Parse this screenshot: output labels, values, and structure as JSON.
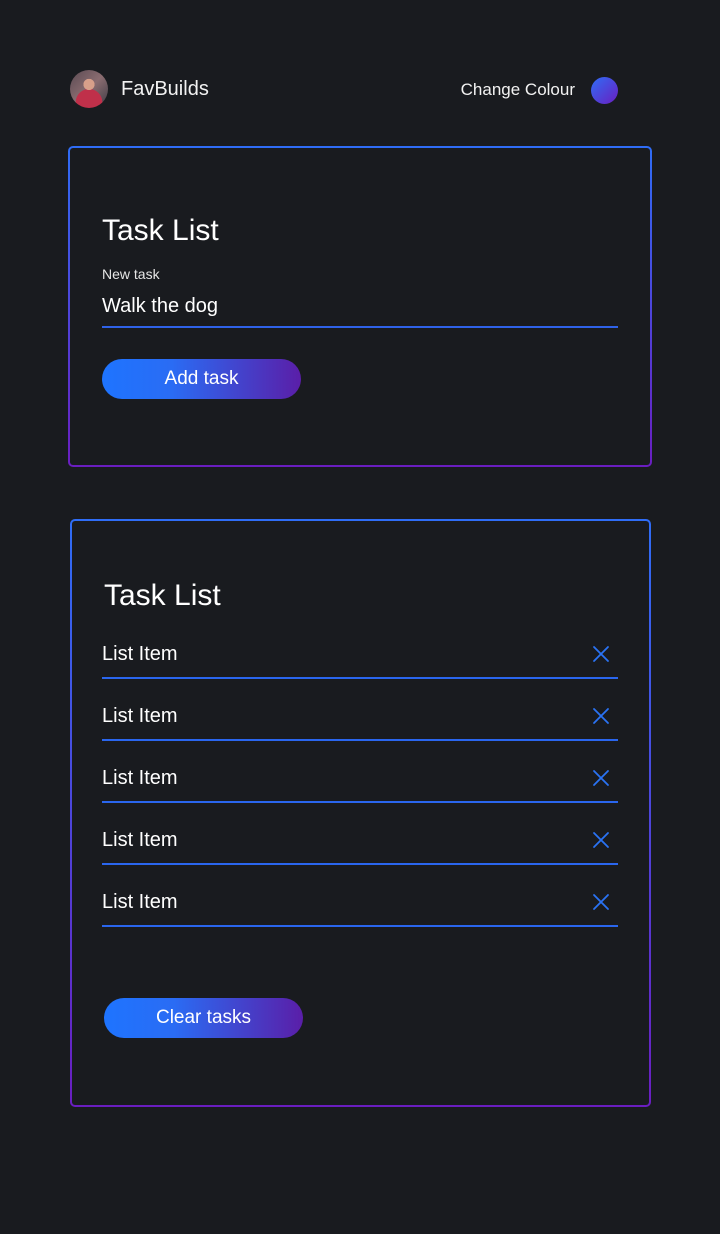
{
  "header": {
    "brand": "FavBuilds",
    "change_colour_label": "Change Colour"
  },
  "colors": {
    "background": "#191b1f",
    "accent_start": "#1e74ff",
    "accent_end": "#5a1ea8",
    "underline": "#2a66ee"
  },
  "new_task_card": {
    "title": "Task List",
    "field_label": "New task",
    "input_value": "Walk the dog",
    "add_button_label": "Add task"
  },
  "task_list_card": {
    "title": "Task List",
    "items": [
      {
        "label": "List Item",
        "icon": "close-icon"
      },
      {
        "label": "List Item",
        "icon": "close-icon"
      },
      {
        "label": "List Item",
        "icon": "close-icon"
      },
      {
        "label": "List Item",
        "icon": "close-icon"
      },
      {
        "label": "List Item",
        "icon": "close-icon"
      }
    ],
    "clear_button_label": "Clear tasks"
  }
}
